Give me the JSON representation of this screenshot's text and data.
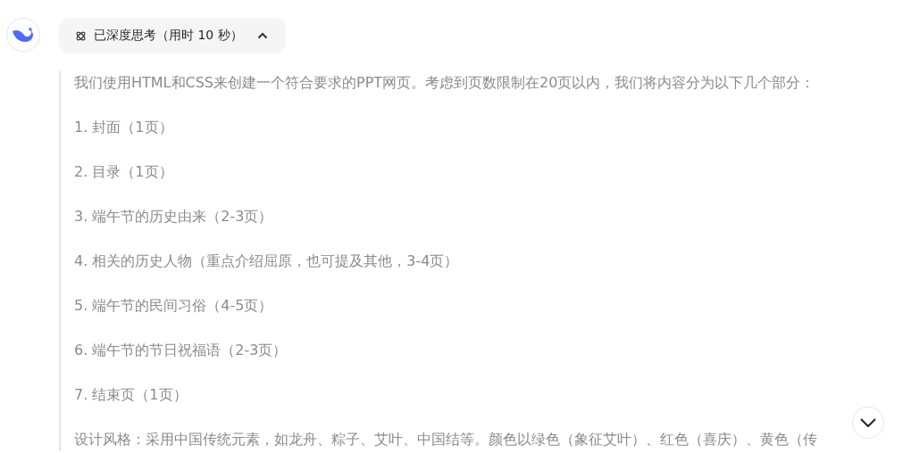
{
  "thinking": {
    "label": "已深度思考（用时 10 秒）",
    "expanded": true
  },
  "paragraphs": [
    "我们使用HTML和CSS来创建一个符合要求的PPT网页。考虑到页数限制在20页以内，我们将内容分为以下几个部分：",
    "1. 封面（1页）",
    "2. 目录（1页）",
    "3. 端午节的历史由来（2-3页）",
    "4. 相关的历史人物（重点介绍屈原，也可提及其他，3-4页）",
    "5. 端午节的民间习俗（4-5页）",
    "6. 端午节的节日祝福语（2-3页）",
    "7. 结束页（1页）",
    "设计风格：采用中国传统元素，如龙舟、粽子、艾叶、中国结等。颜色以绿色（象征艾叶）、红色（喜庆）、黄色（传"
  ]
}
